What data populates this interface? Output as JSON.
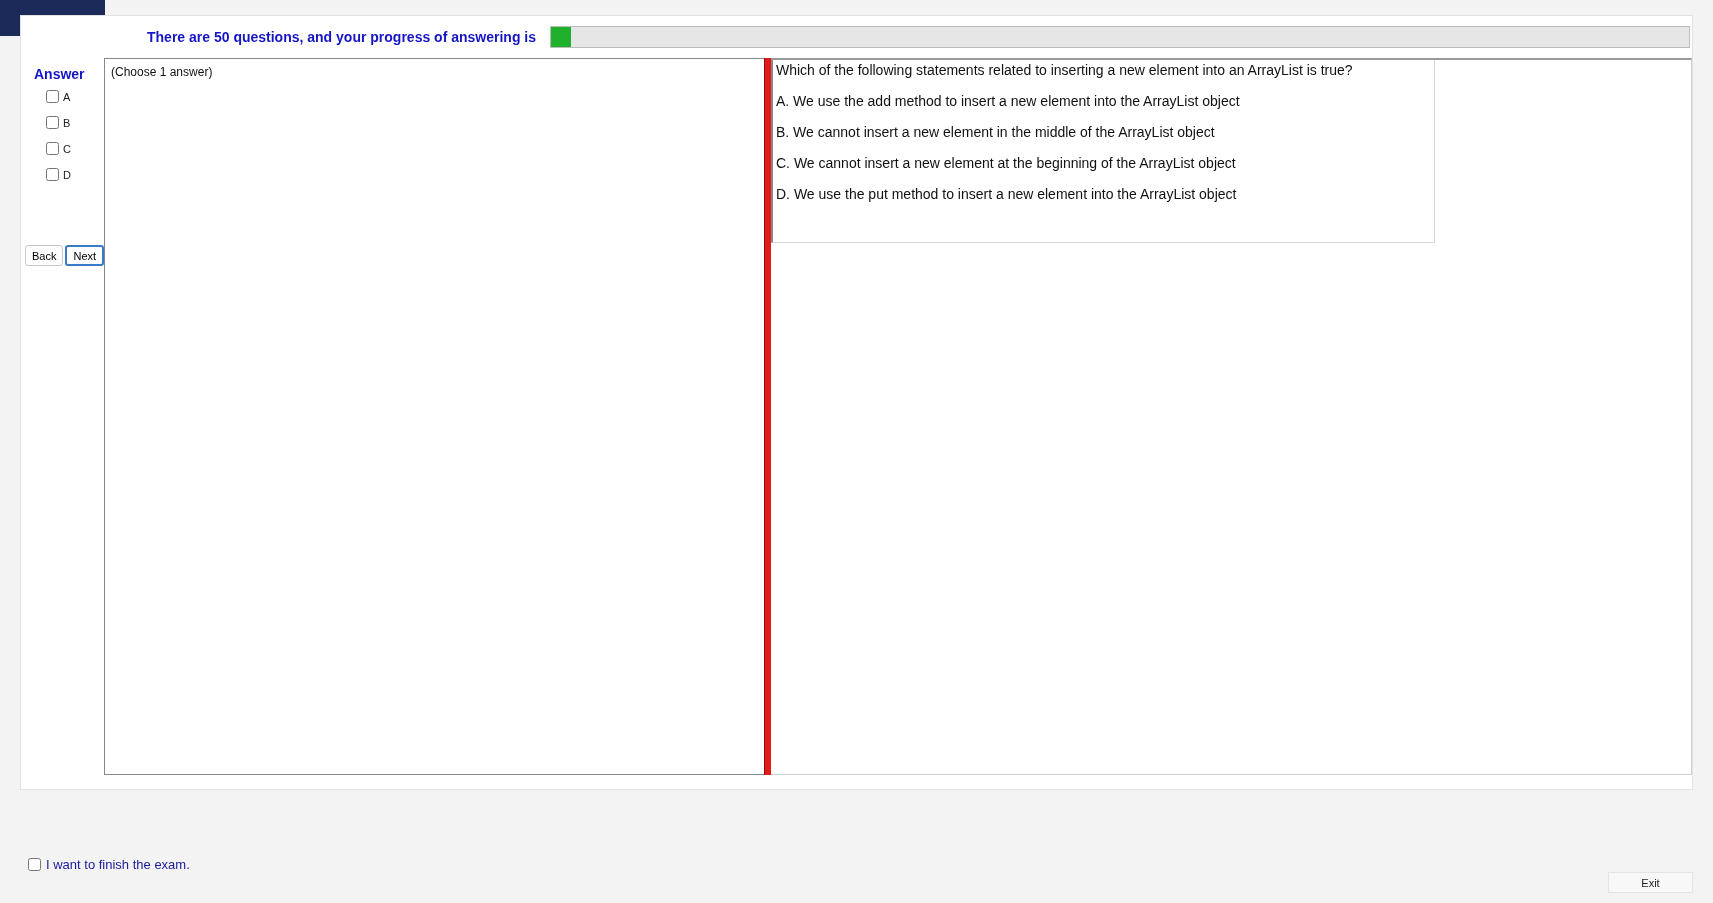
{
  "header": {
    "text": "There are 50 questions, and your progress of answering is",
    "progress": {
      "level": 0.018
    }
  },
  "answer_panel": {
    "title": "Answer",
    "options": [
      {
        "label": "A",
        "checked": false
      },
      {
        "label": "B",
        "checked": false
      },
      {
        "label": "C",
        "checked": false
      },
      {
        "label": "D",
        "checked": false
      }
    ],
    "buttons": [
      {
        "label": "Back",
        "focused": false
      },
      {
        "label": "Next",
        "focused": true
      }
    ]
  },
  "instruction": "(Choose 1 answer)",
  "question": {
    "text": "Which of the following statements related to inserting a new element into an ArrayList is true?",
    "choices": [
      "A.  We use the add method to insert a new element into the ArrayList object",
      "B.  We cannot insert a new element in the middle of the ArrayList object",
      "C.  We cannot insert a new element at the beginning of the ArrayList object",
      "D.  We use the put method to insert a new element into the ArrayList object"
    ]
  },
  "finish": {
    "label": "I want to finish the exam.",
    "checked": false
  },
  "exit_button": "Exit"
}
